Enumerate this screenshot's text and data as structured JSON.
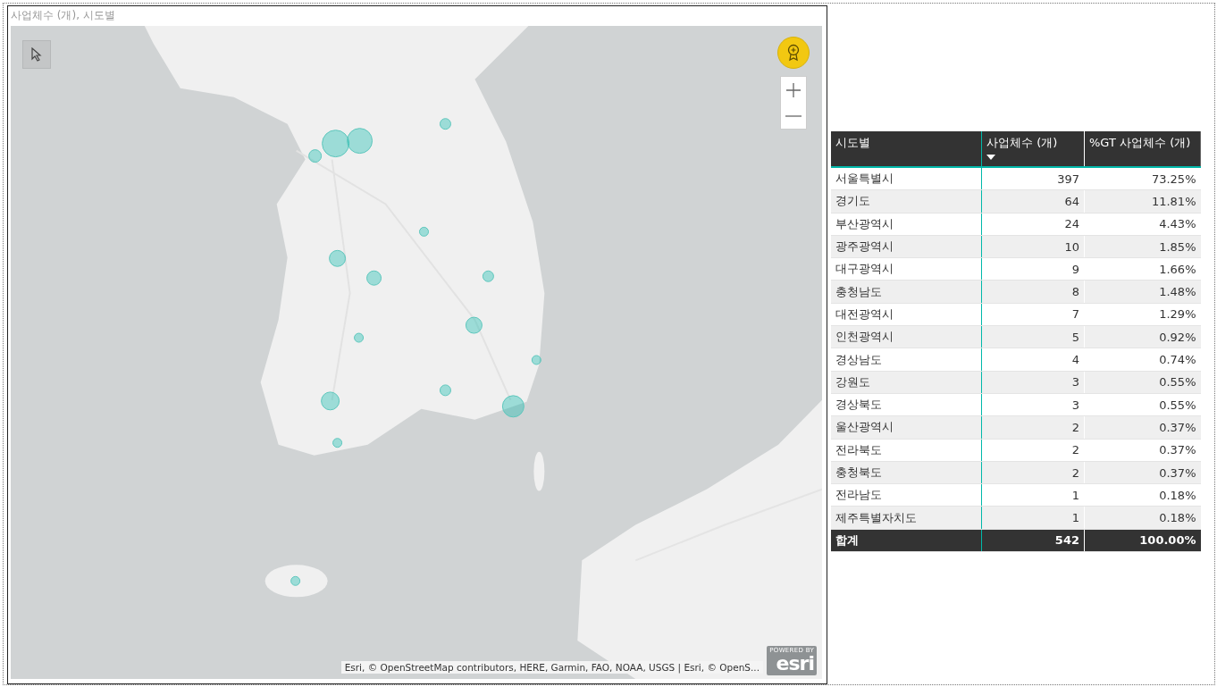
{
  "map_visual": {
    "title": "사업체수 (개), 시도별",
    "attribution": "Esri, © OpenStreetMap contributors, HERE, Garmin, FAO, NOAA, USGS | Esri, © OpenS...",
    "logo": {
      "tagline": "POWERED BY",
      "name": "esri"
    }
  },
  "table": {
    "columns": [
      {
        "label": "시도별",
        "sorted": false
      },
      {
        "label": "사업체수 (개)",
        "sorted": true
      },
      {
        "label": "%GT 사업체수 (개)",
        "sorted": false
      }
    ],
    "rows": [
      [
        "서울특별시",
        "397",
        "73.25%"
      ],
      [
        "경기도",
        "64",
        "11.81%"
      ],
      [
        "부산광역시",
        "24",
        "4.43%"
      ],
      [
        "광주광역시",
        "10",
        "1.85%"
      ],
      [
        "대구광역시",
        "9",
        "1.66%"
      ],
      [
        "충청남도",
        "8",
        "1.48%"
      ],
      [
        "대전광역시",
        "7",
        "1.29%"
      ],
      [
        "인천광역시",
        "5",
        "0.92%"
      ],
      [
        "경상남도",
        "4",
        "0.74%"
      ],
      [
        "강원도",
        "3",
        "0.55%"
      ],
      [
        "경상북도",
        "3",
        "0.55%"
      ],
      [
        "울산광역시",
        "2",
        "0.37%"
      ],
      [
        "전라북도",
        "2",
        "0.37%"
      ],
      [
        "충청북도",
        "2",
        "0.37%"
      ],
      [
        "전라남도",
        "1",
        "0.18%"
      ],
      [
        "제주특별자치도",
        "1",
        "0.18%"
      ]
    ],
    "total": [
      "합계",
      "542",
      "100.00%"
    ]
  }
}
